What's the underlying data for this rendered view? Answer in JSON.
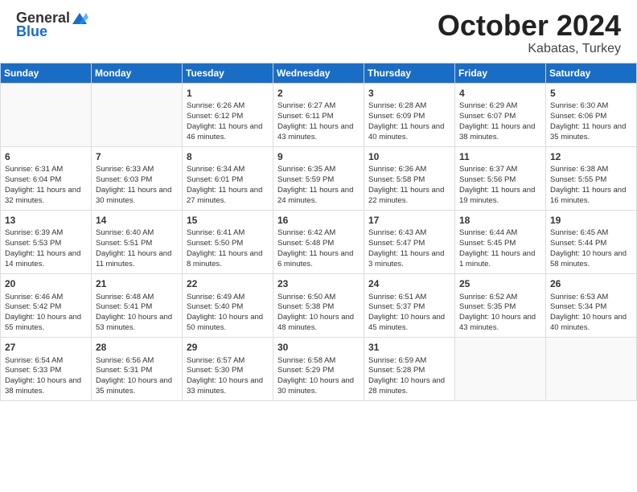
{
  "header": {
    "logo_general": "General",
    "logo_blue": "Blue",
    "title": "October 2024",
    "location": "Kabatas, Turkey"
  },
  "days_of_week": [
    "Sunday",
    "Monday",
    "Tuesday",
    "Wednesday",
    "Thursday",
    "Friday",
    "Saturday"
  ],
  "weeks": [
    [
      {
        "day": "",
        "info": ""
      },
      {
        "day": "",
        "info": ""
      },
      {
        "day": "1",
        "info": "Sunrise: 6:26 AM\nSunset: 6:12 PM\nDaylight: 11 hours and 46 minutes."
      },
      {
        "day": "2",
        "info": "Sunrise: 6:27 AM\nSunset: 6:11 PM\nDaylight: 11 hours and 43 minutes."
      },
      {
        "day": "3",
        "info": "Sunrise: 6:28 AM\nSunset: 6:09 PM\nDaylight: 11 hours and 40 minutes."
      },
      {
        "day": "4",
        "info": "Sunrise: 6:29 AM\nSunset: 6:07 PM\nDaylight: 11 hours and 38 minutes."
      },
      {
        "day": "5",
        "info": "Sunrise: 6:30 AM\nSunset: 6:06 PM\nDaylight: 11 hours and 35 minutes."
      }
    ],
    [
      {
        "day": "6",
        "info": "Sunrise: 6:31 AM\nSunset: 6:04 PM\nDaylight: 11 hours and 32 minutes."
      },
      {
        "day": "7",
        "info": "Sunrise: 6:33 AM\nSunset: 6:03 PM\nDaylight: 11 hours and 30 minutes."
      },
      {
        "day": "8",
        "info": "Sunrise: 6:34 AM\nSunset: 6:01 PM\nDaylight: 11 hours and 27 minutes."
      },
      {
        "day": "9",
        "info": "Sunrise: 6:35 AM\nSunset: 5:59 PM\nDaylight: 11 hours and 24 minutes."
      },
      {
        "day": "10",
        "info": "Sunrise: 6:36 AM\nSunset: 5:58 PM\nDaylight: 11 hours and 22 minutes."
      },
      {
        "day": "11",
        "info": "Sunrise: 6:37 AM\nSunset: 5:56 PM\nDaylight: 11 hours and 19 minutes."
      },
      {
        "day": "12",
        "info": "Sunrise: 6:38 AM\nSunset: 5:55 PM\nDaylight: 11 hours and 16 minutes."
      }
    ],
    [
      {
        "day": "13",
        "info": "Sunrise: 6:39 AM\nSunset: 5:53 PM\nDaylight: 11 hours and 14 minutes."
      },
      {
        "day": "14",
        "info": "Sunrise: 6:40 AM\nSunset: 5:51 PM\nDaylight: 11 hours and 11 minutes."
      },
      {
        "day": "15",
        "info": "Sunrise: 6:41 AM\nSunset: 5:50 PM\nDaylight: 11 hours and 8 minutes."
      },
      {
        "day": "16",
        "info": "Sunrise: 6:42 AM\nSunset: 5:48 PM\nDaylight: 11 hours and 6 minutes."
      },
      {
        "day": "17",
        "info": "Sunrise: 6:43 AM\nSunset: 5:47 PM\nDaylight: 11 hours and 3 minutes."
      },
      {
        "day": "18",
        "info": "Sunrise: 6:44 AM\nSunset: 5:45 PM\nDaylight: 11 hours and 1 minute."
      },
      {
        "day": "19",
        "info": "Sunrise: 6:45 AM\nSunset: 5:44 PM\nDaylight: 10 hours and 58 minutes."
      }
    ],
    [
      {
        "day": "20",
        "info": "Sunrise: 6:46 AM\nSunset: 5:42 PM\nDaylight: 10 hours and 55 minutes."
      },
      {
        "day": "21",
        "info": "Sunrise: 6:48 AM\nSunset: 5:41 PM\nDaylight: 10 hours and 53 minutes."
      },
      {
        "day": "22",
        "info": "Sunrise: 6:49 AM\nSunset: 5:40 PM\nDaylight: 10 hours and 50 minutes."
      },
      {
        "day": "23",
        "info": "Sunrise: 6:50 AM\nSunset: 5:38 PM\nDaylight: 10 hours and 48 minutes."
      },
      {
        "day": "24",
        "info": "Sunrise: 6:51 AM\nSunset: 5:37 PM\nDaylight: 10 hours and 45 minutes."
      },
      {
        "day": "25",
        "info": "Sunrise: 6:52 AM\nSunset: 5:35 PM\nDaylight: 10 hours and 43 minutes."
      },
      {
        "day": "26",
        "info": "Sunrise: 6:53 AM\nSunset: 5:34 PM\nDaylight: 10 hours and 40 minutes."
      }
    ],
    [
      {
        "day": "27",
        "info": "Sunrise: 6:54 AM\nSunset: 5:33 PM\nDaylight: 10 hours and 38 minutes."
      },
      {
        "day": "28",
        "info": "Sunrise: 6:56 AM\nSunset: 5:31 PM\nDaylight: 10 hours and 35 minutes."
      },
      {
        "day": "29",
        "info": "Sunrise: 6:57 AM\nSunset: 5:30 PM\nDaylight: 10 hours and 33 minutes."
      },
      {
        "day": "30",
        "info": "Sunrise: 6:58 AM\nSunset: 5:29 PM\nDaylight: 10 hours and 30 minutes."
      },
      {
        "day": "31",
        "info": "Sunrise: 6:59 AM\nSunset: 5:28 PM\nDaylight: 10 hours and 28 minutes."
      },
      {
        "day": "",
        "info": ""
      },
      {
        "day": "",
        "info": ""
      }
    ]
  ]
}
